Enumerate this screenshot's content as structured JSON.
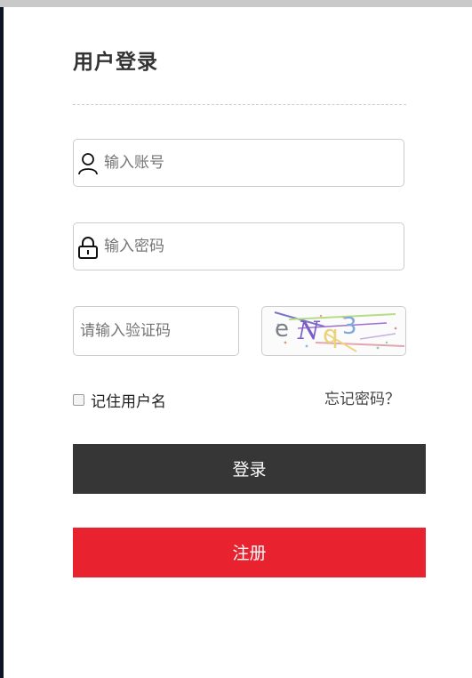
{
  "form": {
    "title": "用户登录",
    "username_placeholder": "输入账号",
    "password_placeholder": "输入密码",
    "captcha_placeholder": "请输入验证码",
    "captcha_chars": [
      "e",
      "N",
      "q",
      "3"
    ],
    "remember_label": "记住用户名",
    "forgot_label": "忘记密码？",
    "login_label": "登录",
    "register_label": "注册"
  },
  "colors": {
    "login_button": "#363636",
    "register_button": "#e8232f",
    "panel_background": "#ffffff",
    "page_background": "#0c1426"
  },
  "icons": {
    "username": "user-icon",
    "password": "lock-icon"
  }
}
